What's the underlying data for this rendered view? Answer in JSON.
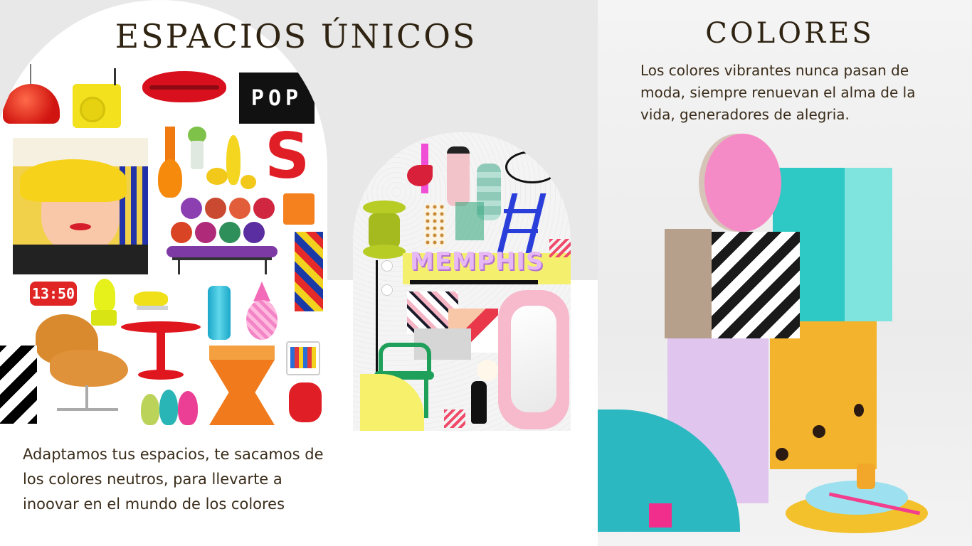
{
  "left": {
    "title": "ESPACIOS ÚNICOS",
    "description": "Adaptamos tus espacios, te sacamos de los colores neutros, para llevarte a inoovar en el mundo de los colores",
    "collage_texts": {
      "pop": "POP",
      "clock": "13:50",
      "memphis": "MEMPHIS",
      "letter": "S"
    }
  },
  "right": {
    "title": "COLORES",
    "description": "Los colores vibrantes nunca pasan de moda, siempre renuevan el alma de la vida, generadores de alegria."
  },
  "colors": {
    "text": "#2f2312",
    "accent_red": "#e01e25",
    "accent_yellow": "#f2d81e",
    "accent_teal": "#2ec9c4",
    "accent_pink": "#f48ec8",
    "accent_lilac": "#d9b8ee",
    "accent_orange": "#f2a72a"
  }
}
